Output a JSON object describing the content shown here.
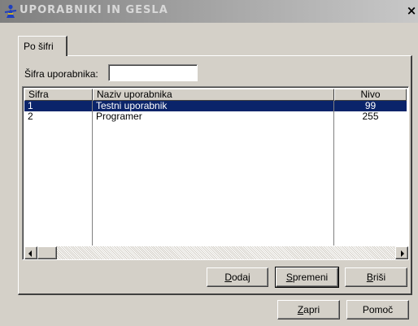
{
  "window": {
    "title": "UPORABNIKI IN GESLA",
    "close_glyph": "×"
  },
  "tab": {
    "label": "Po šifri"
  },
  "search": {
    "label": "Šifra uporabnika:",
    "value": ""
  },
  "table": {
    "columns": [
      "Sifra",
      "Naziv uporabnika",
      "Nivo"
    ],
    "rows": [
      {
        "sifra": "1",
        "naziv": "Testni uporabnik",
        "nivo": "99",
        "selected": true
      },
      {
        "sifra": "2",
        "naziv": "Programer",
        "nivo": "255",
        "selected": false
      }
    ]
  },
  "buttons": {
    "dodaj": {
      "mnemonic": "D",
      "rest": "odaj"
    },
    "spremeni": {
      "mnemonic": "S",
      "rest": "premeni"
    },
    "brisi": {
      "mnemonic": "B",
      "rest": "riši"
    },
    "zapri": {
      "mnemonic": "Z",
      "rest": "apri"
    },
    "pomoc": {
      "label": "Pomoč"
    }
  },
  "icons": {
    "app": "user-figure-icon",
    "scroll_left": "arrow-left-icon",
    "scroll_right": "arrow-right-icon"
  },
  "colors": {
    "selection": "#0a246a",
    "face": "#d4d0c8",
    "title_gradient_start": "#7f7f7f"
  }
}
